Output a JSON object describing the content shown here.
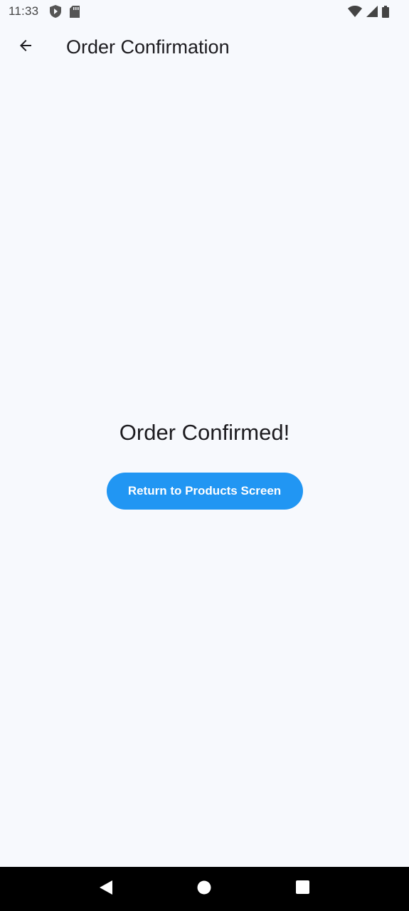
{
  "status_bar": {
    "time": "11:33",
    "left_icons": [
      "shield-icon",
      "sd-card-icon"
    ],
    "right_icons": [
      "wifi-icon",
      "signal-icon",
      "battery-icon"
    ]
  },
  "app_bar": {
    "back_icon": "arrow-back-icon",
    "title": "Order Confirmation"
  },
  "main": {
    "heading": "Order Confirmed!",
    "return_button_label": "Return to Products Screen"
  },
  "nav_bar": {
    "buttons": [
      "back-triangle-icon",
      "home-circle-icon",
      "recents-square-icon"
    ]
  },
  "colors": {
    "background": "#f7f9fd",
    "accent": "#2196f3",
    "nav_bar": "#000000"
  }
}
